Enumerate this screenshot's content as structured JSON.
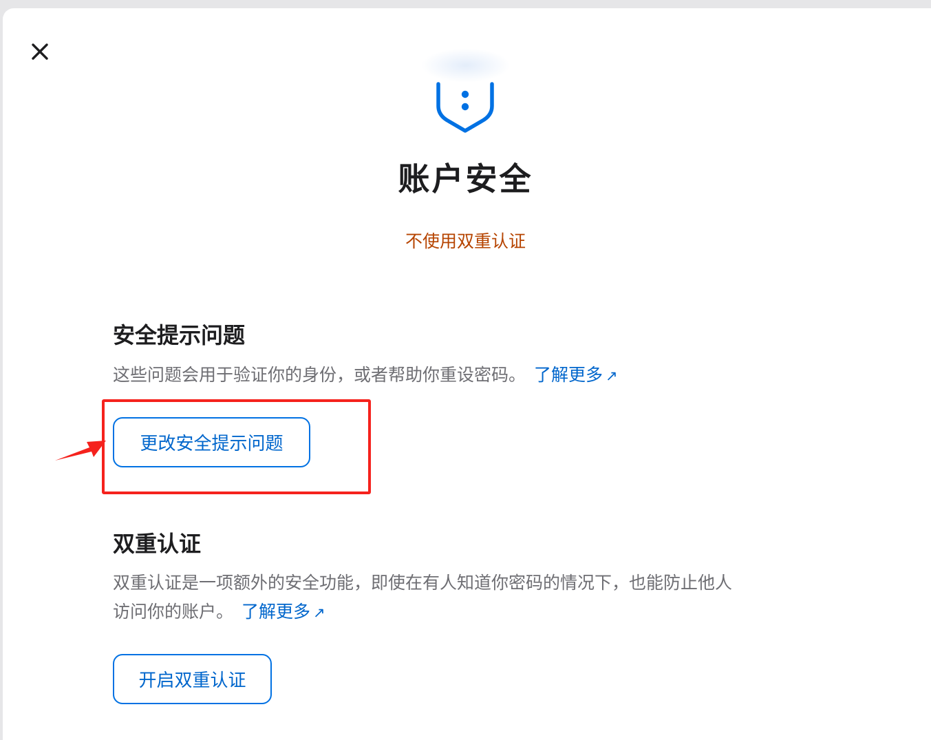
{
  "dialog": {
    "close_icon": "close-icon",
    "hero_icon": "shield-icon",
    "title": "账户安全",
    "status": "不使用双重认证"
  },
  "security_questions": {
    "heading": "安全提示问题",
    "description": "这些问题会用于验证你的身份，或者帮助你重设密码。",
    "learn_more": "了解更多",
    "button_label": "更改安全提示问题"
  },
  "two_factor": {
    "heading": "双重认证",
    "description_line1": "双重认证是一项额外的安全功能，即使在有人知道你密码的情况下，也能防止他人",
    "description_line2": "访问你的账户。",
    "learn_more": "了解更多",
    "button_label": "开启双重认证"
  },
  "annotation": {
    "highlight_color": "#f5221d",
    "pointer": "arrow-pointer"
  },
  "colors": {
    "accent": "#0066cc",
    "button_border": "#0071e3",
    "status_warning": "#b64400",
    "title": "#1d1d1f",
    "body_text": "#6e6e73"
  }
}
